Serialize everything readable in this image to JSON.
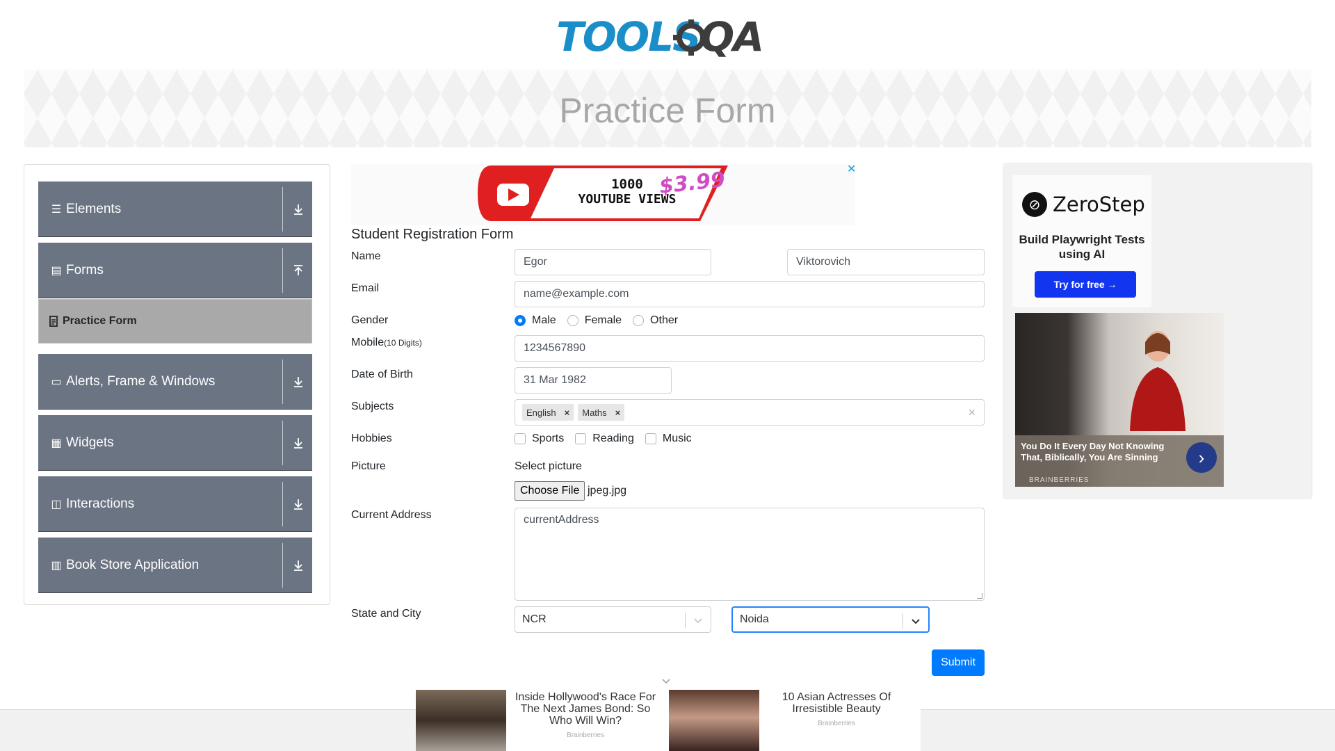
{
  "header": {
    "logo_text_a": "TOOLS",
    "logo_text_b": "QA"
  },
  "banner": {
    "title": "Practice Form"
  },
  "sidebar": {
    "groups": [
      {
        "label": "Elements",
        "icon": "hamburger-icon",
        "arrow": "download-icon"
      },
      {
        "label": "Forms",
        "icon": "document-icon",
        "arrow": "upload-icon"
      },
      {
        "label": "Alerts, Frame & Windows",
        "icon": "window-icon",
        "arrow": "download-icon"
      },
      {
        "label": "Widgets",
        "icon": "widgets-icon",
        "arrow": "download-icon"
      },
      {
        "label": "Interactions",
        "icon": "interactions-icon",
        "arrow": "download-icon"
      },
      {
        "label": "Book Store Application",
        "icon": "books-icon",
        "arrow": "download-icon"
      }
    ],
    "active_item": {
      "label": "Practice Form",
      "icon": "document-icon"
    }
  },
  "top_ad": {
    "text_line1": "1000",
    "text_line2": "YOUTUBE VIEWS",
    "price": "$3.99",
    "close": "✕"
  },
  "form": {
    "title": "Student Registration Form",
    "name": {
      "label": "Name",
      "first": "Egor",
      "last": "Viktorovich"
    },
    "email": {
      "label": "Email",
      "placeholder": "name@example.com"
    },
    "gender": {
      "label": "Gender",
      "options": [
        "Male",
        "Female",
        "Other"
      ],
      "selected": "Male"
    },
    "mobile": {
      "label": "Mobile",
      "hint": "(10 Digits)",
      "value": "1234567890"
    },
    "dob": {
      "label": "Date of Birth",
      "value": "31 Mar 1982"
    },
    "subjects": {
      "label": "Subjects",
      "chips": [
        "English",
        "Maths"
      ],
      "chip_remove": "×",
      "clear": "×"
    },
    "hobbies": {
      "label": "Hobbies",
      "options": [
        "Sports",
        "Reading",
        "Music"
      ],
      "checked": []
    },
    "picture": {
      "label": "Picture",
      "select_label": "Select picture",
      "button": "Choose File",
      "file": "jpeg.jpg"
    },
    "address": {
      "label": "Current Address",
      "placeholder": "currentAddress"
    },
    "state_city": {
      "label": "State and City",
      "state": "NCR",
      "city": "Noida"
    },
    "submit": "Submit"
  },
  "right_ad": {
    "brand": "ZeroStep",
    "tagline": "Build Playwright Tests using AI",
    "cta": "Try for free →",
    "story": "You Do It Every Day Not Knowing That, Biblically, You Are Sinning",
    "source": "BRAINBERRIES",
    "next": "›"
  },
  "bottom_ad": {
    "story1": "Inside Hollywood's Race For The Next James Bond: So Who Will Win?",
    "source1": "Brainberries",
    "story2": "10 Asian Actresses Of Irresistible Beauty",
    "source2": "Brainberries"
  },
  "colors": {
    "accent": "#007bff",
    "sidebar_group": "#6b7482",
    "sidebar_active": "#a9a9a9",
    "logo_blue": "#1a8ec8",
    "cta_blue": "#1236f0"
  }
}
